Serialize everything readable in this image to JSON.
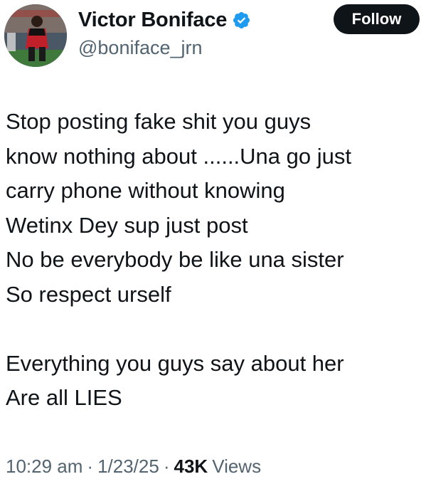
{
  "user": {
    "display_name": "Victor Boniface",
    "handle": "@boniface_jrn",
    "verified": true,
    "avatar": "profile-photo"
  },
  "actions": {
    "follow_label": "Follow"
  },
  "tweet": {
    "lines": [
      "Stop posting fake shit you guys",
      "know nothing about ......Una go just",
      "carry phone without knowing",
      "Wetinx Dey sup just post",
      "No be everybody be like una sister",
      "So respect urself",
      "",
      "Everything you guys say about her",
      "Are all LIES"
    ]
  },
  "meta": {
    "time": "10:29 am",
    "date": "1/23/25",
    "separator": "·",
    "views_count": "43K",
    "views_label": "Views"
  },
  "colors": {
    "text": "#0f1419",
    "secondary": "#536471",
    "verified": "#1d9bf0",
    "button_bg": "#0f1419",
    "button_text": "#ffffff"
  }
}
